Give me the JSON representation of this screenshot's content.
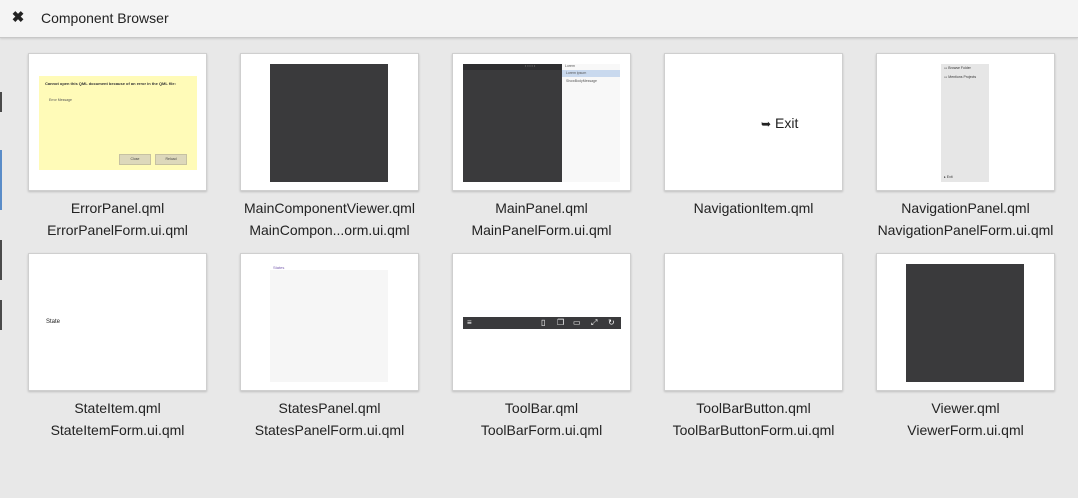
{
  "window": {
    "title": "Component Browser",
    "close_icon": "close-icon"
  },
  "components": [
    {
      "name": "ErrorPanel.qml",
      "form": "ErrorPanelForm.ui.qml"
    },
    {
      "name": "MainComponentViewer.qml",
      "form": "MainCompon...orm.ui.qml"
    },
    {
      "name": "MainPanel.qml",
      "form": "MainPanelForm.ui.qml"
    },
    {
      "name": "NavigationItem.qml",
      "form": ""
    },
    {
      "name": "NavigationPanel.qml",
      "form": "NavigationPanelForm.ui.qml"
    },
    {
      "name": "StateItem.qml",
      "form": "StateItemForm.ui.qml"
    },
    {
      "name": "StatesPanel.qml",
      "form": "StatesPanelForm.ui.qml"
    },
    {
      "name": "ToolBar.qml",
      "form": "ToolBarForm.ui.qml"
    },
    {
      "name": "ToolBarButton.qml",
      "form": "ToolBarButtonForm.ui.qml"
    },
    {
      "name": "Viewer.qml",
      "form": "ViewerForm.ui.qml"
    }
  ],
  "previews": {
    "error_panel": {
      "title": "Cannot open this QML document because of an error in the QML file:",
      "message": "Error Message",
      "close_label": "Close",
      "reload_label": "Reload"
    },
    "main_panel": {
      "side_header": "Lorem",
      "side_selected": "Lorem ipsum",
      "side_item": "ShowBodyMessage"
    },
    "navigation_item": {
      "label": "Exit",
      "icon": "exit-icon"
    },
    "navigation_panel": {
      "browse": "Browse Folder",
      "recent": "Mentions Projects",
      "exit": "Exit"
    },
    "state_item": {
      "label": "State"
    },
    "states_panel": {
      "title": "States"
    },
    "toolbar": {
      "icons": [
        "menu-icon",
        "file-icon",
        "copy-icon",
        "window-icon",
        "expand-icon",
        "refresh-icon"
      ]
    }
  },
  "colors": {
    "dark_preview": "#3a3a3c",
    "error_bg": "#fffbb8",
    "accent": "#5a8cc8"
  }
}
